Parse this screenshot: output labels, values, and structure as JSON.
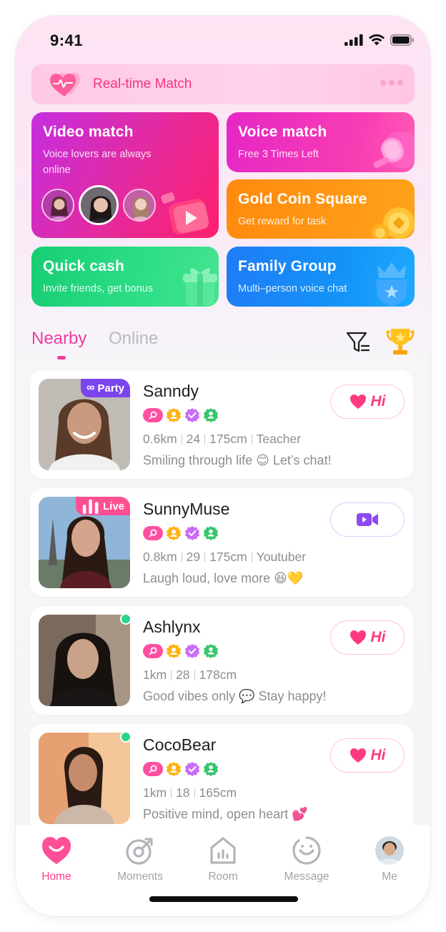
{
  "status_bar": {
    "time": "9:41"
  },
  "realtime": {
    "title": "Real-time Match"
  },
  "cards": {
    "video": {
      "title": "Video match",
      "subtitle": "Voice lovers are always online"
    },
    "voice": {
      "title": "Voice match",
      "subtitle": "Free 3 Times Left"
    },
    "gold": {
      "title": "Gold Coin Square",
      "subtitle": "Get reward for task"
    },
    "cash": {
      "title": "Quick cash",
      "subtitle": "Invite friends, get bonus"
    },
    "family": {
      "title": "Family Group",
      "subtitle": "Multi–person voice chat"
    }
  },
  "tabs": {
    "nearby": "Nearby",
    "online": "Online"
  },
  "users": [
    {
      "name": "Sanndy",
      "tag": "Party",
      "distance": "0.6km",
      "age": "24",
      "height": "175cm",
      "job": "Teacher",
      "bio": "Smiling through life 😊 Let’s chat!",
      "action": "Hi"
    },
    {
      "name": "SunnyMuse",
      "tag": "Live",
      "distance": "0.8km",
      "age": "29",
      "height": "175cm",
      "job": "Youtuber",
      "bio": "Laugh loud, love more 😆💛"
    },
    {
      "name": "Ashlynx",
      "distance": "1km",
      "age": "28",
      "height": "178cm",
      "bio": "Good vibes only 💬 Stay happy!",
      "action": "Hi"
    },
    {
      "name": "CocoBear",
      "distance": "1km",
      "age": "18",
      "height": "165cm",
      "bio": "Positive mind, open heart 💕",
      "action": "Hi"
    }
  ],
  "nav": {
    "home": "Home",
    "moments": "Moments",
    "room": "Room",
    "message": "Message",
    "me": "Me"
  },
  "colors": {
    "accent": "#ff3f8f",
    "party_tag": "#7a45ef",
    "live_tag": "#ff4f93",
    "online_dot": "#2bd38b"
  }
}
